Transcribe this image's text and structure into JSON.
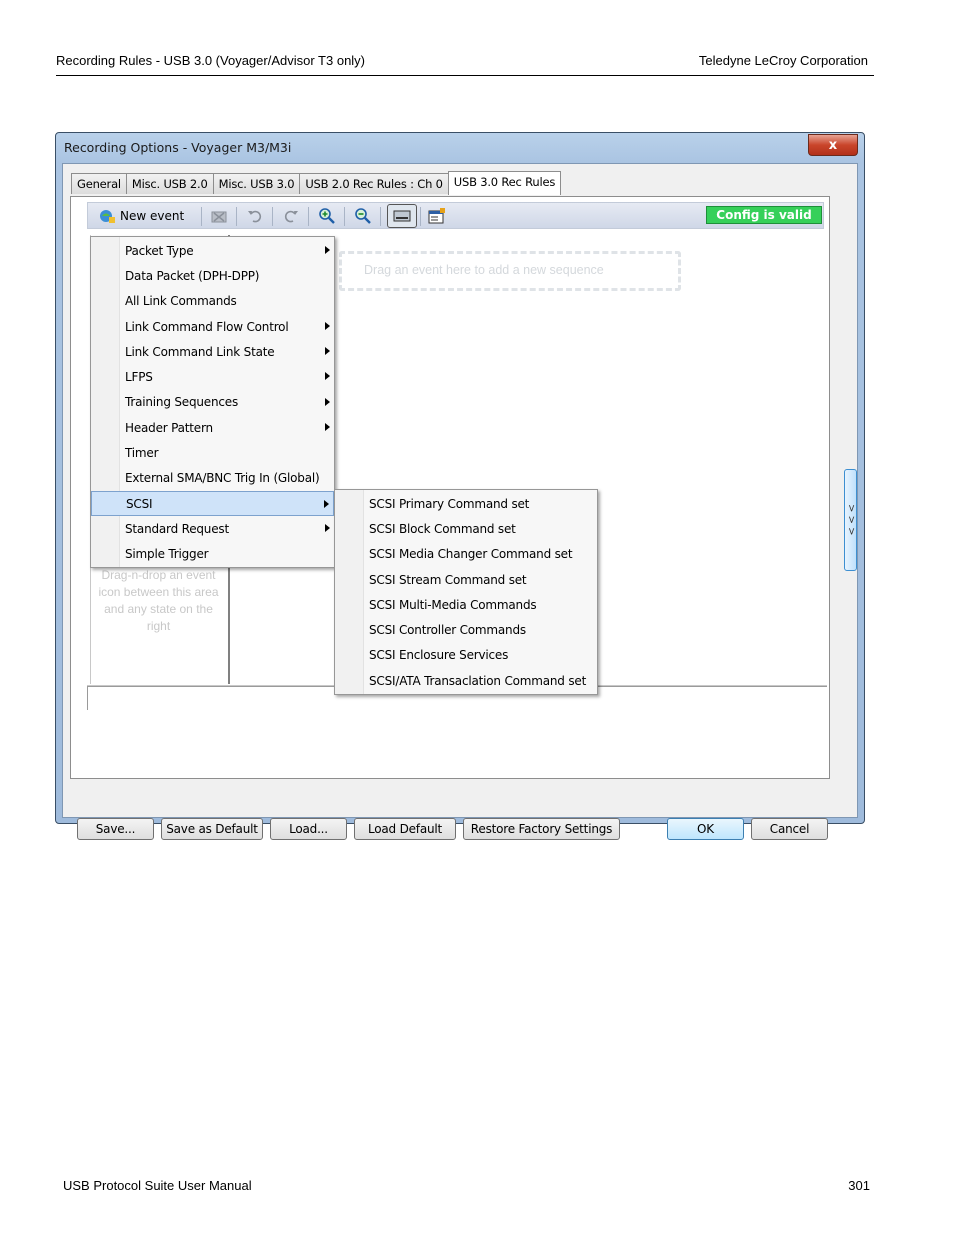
{
  "page": {
    "header_left": "Recording Rules - USB 3.0 (Voyager/Advisor T3 only)",
    "header_right": "Teledyne LeCroy Corporation",
    "footer_left": "USB Protocol Suite User Manual",
    "footer_right": "301"
  },
  "window": {
    "title": "Recording Options - Voyager M3/M3i",
    "close_label": "x"
  },
  "tabs": [
    {
      "label": "General"
    },
    {
      "label": "Misc. USB 2.0"
    },
    {
      "label": "Misc. USB 3.0"
    },
    {
      "label": "USB 2.0 Rec Rules : Ch 0"
    },
    {
      "label": "USB 3.0 Rec Rules",
      "active": true
    }
  ],
  "toolbar": {
    "new_event_label": "New event",
    "config_status": "Config is valid",
    "config_color": "#35d05a"
  },
  "workspace": {
    "sequence_drop_hint": "Drag an event here to add a new sequence",
    "left_drop_hint": "Drag-n-drop an event icon between this area and any state on the right",
    "side_handle": "> > >"
  },
  "menu": {
    "items": [
      {
        "label": "Packet Type",
        "submenu": true
      },
      {
        "label": "Data Packet (DPH-DPP)",
        "submenu": false
      },
      {
        "label": "All Link Commands",
        "submenu": false
      },
      {
        "label": "Link Command Flow Control",
        "submenu": true
      },
      {
        "label": "Link Command Link State",
        "submenu": true
      },
      {
        "label": "LFPS",
        "submenu": true
      },
      {
        "label": "Training Sequences",
        "submenu": true
      },
      {
        "label": "Header Pattern",
        "submenu": true
      },
      {
        "label": "Timer",
        "submenu": false
      },
      {
        "label": "External SMA/BNC Trig In (Global)",
        "submenu": false
      },
      {
        "label": "SCSI",
        "submenu": true,
        "highlighted": true
      },
      {
        "label": "Standard Request",
        "submenu": true
      },
      {
        "label": "Simple Trigger",
        "submenu": false
      }
    ]
  },
  "submenu": {
    "items": [
      {
        "label": "SCSI Primary Command set"
      },
      {
        "label": "SCSI Block Command set"
      },
      {
        "label": "SCSI Media Changer Command set"
      },
      {
        "label": "SCSI Stream Command set"
      },
      {
        "label": "SCSI Multi-Media Commands"
      },
      {
        "label": "SCSI Controller Commands"
      },
      {
        "label": "SCSI Enclosure Services"
      },
      {
        "label": "SCSI/ATA Transaclation Command set"
      }
    ]
  },
  "buttons": {
    "save": "Save...",
    "save_default": "Save as Default",
    "load": "Load...",
    "load_default": "Load Default",
    "restore": "Restore Factory Settings",
    "ok": "OK",
    "cancel": "Cancel"
  }
}
